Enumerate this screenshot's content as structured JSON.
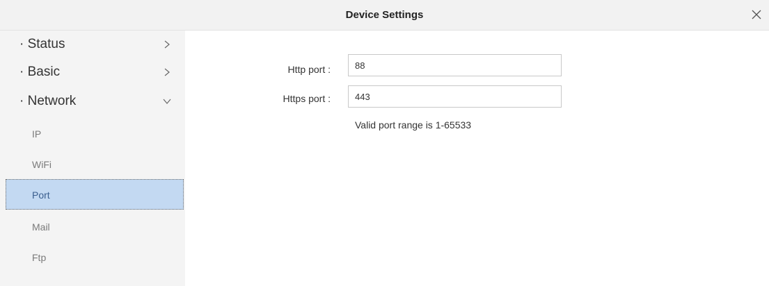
{
  "window": {
    "title": "Device Settings",
    "close_icon": "close-icon"
  },
  "sidebar": {
    "items": [
      {
        "label": "· Status",
        "chevron": "chevron-right-icon"
      },
      {
        "label": "· Basic",
        "chevron": "chevron-right-icon"
      },
      {
        "label": "· Network",
        "chevron": "chevron-down-icon",
        "expanded": true
      }
    ],
    "network_items": [
      {
        "label": "IP"
      },
      {
        "label": "WiFi"
      },
      {
        "label": "Port",
        "selected": true
      },
      {
        "label": "Mail"
      },
      {
        "label": "Ftp"
      }
    ]
  },
  "form": {
    "http_port": {
      "label": "Http port :",
      "value": "88"
    },
    "https_port": {
      "label": "Https port :",
      "value": "443"
    },
    "hint": "Valid port range is 1-65533"
  },
  "colors": {
    "selected_bg": "#c3d9f2",
    "sidebar_bg": "#f4f4f4",
    "titlebar_bg": "#f2f2f2"
  }
}
